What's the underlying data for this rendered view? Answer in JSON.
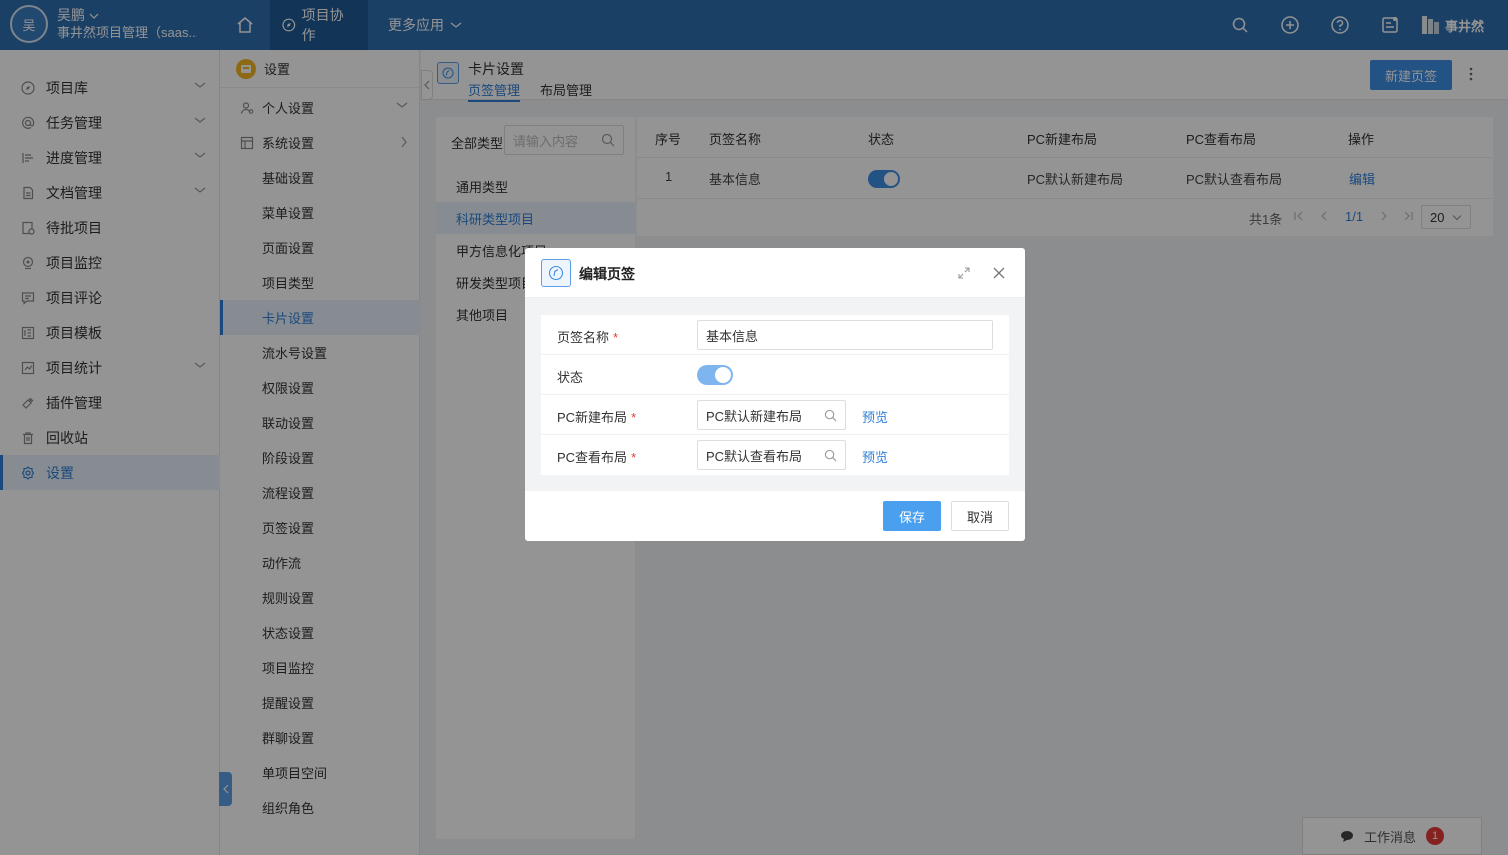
{
  "topbar": {
    "avatar_text": "吴",
    "user_name": "吴鹏",
    "org_name": "事井然项目管理（saas...",
    "nav_tabs": [
      {
        "label": "项目协作",
        "active": true
      },
      {
        "label": "更多应用",
        "active": false
      }
    ],
    "brand_name": "事井然"
  },
  "sidebar": {
    "items": [
      {
        "label": "项目库",
        "icon": "compass-icon",
        "has_chevron": true
      },
      {
        "label": "任务管理",
        "icon": "at-icon",
        "has_chevron": true
      },
      {
        "label": "进度管理",
        "icon": "progress-icon",
        "has_chevron": true
      },
      {
        "label": "文档管理",
        "icon": "document-icon",
        "has_chevron": true
      },
      {
        "label": "待批项目",
        "icon": "pending-icon",
        "has_chevron": false
      },
      {
        "label": "项目监控",
        "icon": "monitor-icon",
        "has_chevron": false
      },
      {
        "label": "项目评论",
        "icon": "comment-icon",
        "has_chevron": false
      },
      {
        "label": "项目模板",
        "icon": "template-icon",
        "has_chevron": false
      },
      {
        "label": "项目统计",
        "icon": "stats-icon",
        "has_chevron": true
      },
      {
        "label": "插件管理",
        "icon": "plugin-icon",
        "has_chevron": false
      },
      {
        "label": "回收站",
        "icon": "trash-icon",
        "has_chevron": false
      },
      {
        "label": "设置",
        "icon": "gear-icon",
        "has_chevron": false,
        "active": true
      }
    ]
  },
  "submenu": {
    "header": "设置",
    "groups": [
      {
        "label": "个人设置",
        "chevron": "down"
      },
      {
        "label": "系统设置",
        "chevron": "right"
      }
    ],
    "items": [
      "基础设置",
      "菜单设置",
      "页面设置",
      "项目类型",
      "卡片设置",
      "流水号设置",
      "权限设置",
      "联动设置",
      "阶段设置",
      "流程设置",
      "页签设置",
      "动作流",
      "规则设置",
      "状态设置",
      "项目监控",
      "提醒设置",
      "群聊设置",
      "单项目空间",
      "组织角色"
    ],
    "active_item": "卡片设置"
  },
  "content": {
    "title": "卡片设置",
    "tabs": [
      {
        "label": "页签管理",
        "active": true
      },
      {
        "label": "布局管理",
        "active": false
      }
    ],
    "new_button": "新建页签",
    "type_panel": {
      "label": "全部类型",
      "search_placeholder": "请输入内容",
      "types": [
        "通用类型",
        "科研类型项目",
        "甲方信息化项目",
        "研发类型项目",
        "其他项目"
      ],
      "active_type": "科研类型项目"
    },
    "table": {
      "headers": [
        "序号",
        "页签名称",
        "状态",
        "PC新建布局",
        "PC查看布局",
        "操作"
      ],
      "rows": [
        {
          "index": "1",
          "name": "基本信息",
          "status_on": true,
          "pc_new": "PC默认新建布局",
          "pc_view": "PC默认查看布局",
          "action": "编辑"
        }
      ],
      "total": "共1条",
      "page": "1/1",
      "page_size": "20"
    }
  },
  "message_bar": {
    "label": "工作消息",
    "count": "1"
  },
  "modal": {
    "title": "编辑页签",
    "fields": {
      "name_label": "页签名称",
      "name_value": "基本信息",
      "status_label": "状态",
      "pc_new_label": "PC新建布局",
      "pc_new_value": "PC默认新建布局",
      "pc_view_label": "PC查看布局",
      "pc_view_value": "PC默认查看布局",
      "preview": "预览",
      "required_mark": "*"
    },
    "save": "保存",
    "cancel": "取消"
  },
  "colors": {
    "topbar": "#2f6fb0",
    "accent": "#2f7fd8",
    "primary_button": "#3d8ee6",
    "badge": "#e53935"
  }
}
